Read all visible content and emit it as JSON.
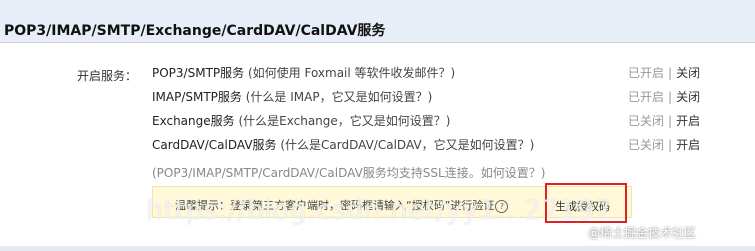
{
  "header": {
    "title": "POP3/IMAP/SMTP/Exchange/CardDAV/CalDAV服务"
  },
  "label": "开启服务：",
  "services": [
    {
      "name": "POP3/SMTP服务",
      "help": "(如何使用 Foxmail 等软件收发邮件？)",
      "status": "已开启",
      "action": "关闭"
    },
    {
      "name": "IMAP/SMTP服务",
      "help": "(什么是 IMAP，它又是如何设置？)",
      "status": "已开启",
      "action": "关闭"
    },
    {
      "name": "Exchange服务",
      "help": "(什么是Exchange，它又是如何设置？)",
      "status": "已关闭",
      "action": "开启"
    },
    {
      "name": "CardDAV/CalDAV服务",
      "help": "(什么是CardDAV/CalDAV，它又是如何设置？)",
      "status": "已关闭",
      "action": "开启"
    }
  ],
  "separator": "|",
  "ssl_note": "(POP3/IMAP/SMTP/CardDAV/CalDAV服务均支持SSL连接。如何设置？)",
  "tip": {
    "text": "温馨提示：登录第三方客户端时，密码框请输入“授权码”进行验证",
    "help_glyph": "?"
  },
  "generate_button": "生成授权码",
  "watermark": {
    "url": "https://blog.csdn.net/yy1…27197",
    "brand": "@稀土掘金技术社区"
  },
  "colors": {
    "header_bg": "#e7eef8",
    "highlight": "#e0221c",
    "tip_bg": "#fff8d9"
  }
}
